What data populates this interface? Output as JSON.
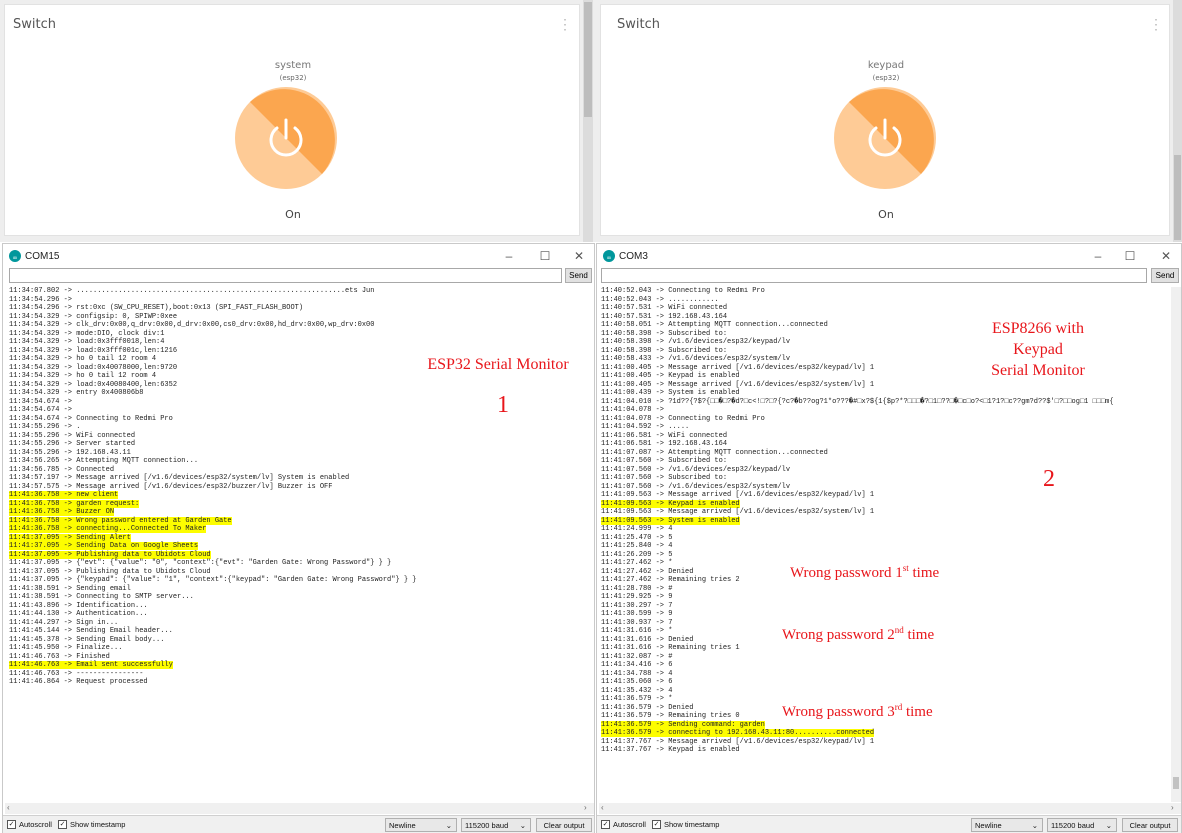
{
  "top_left": {
    "title": "Switch",
    "device": "system",
    "device_sub": "(esp32)",
    "state": "On"
  },
  "top_right": {
    "title": "Switch",
    "device": "keypad",
    "device_sub": "(esp32)",
    "state": "On"
  },
  "left_window": {
    "title": "COM15",
    "send_label": "Send",
    "autoscroll_label": "Autoscroll",
    "timestamp_label": "Show timestamp",
    "line_ending": "Newline",
    "baud": "115200 baud",
    "clear_label": "Clear output",
    "log": [
      {
        "t": "11:34:07.802 -> ................................................................ets Jun"
      },
      {
        "t": "11:34:54.296 ->"
      },
      {
        "t": "11:34:54.296 -> rst:0xc (SW_CPU_RESET),boot:0x13 (SPI_FAST_FLASH_BOOT)"
      },
      {
        "t": "11:34:54.329 -> configsip: 0, SPIWP:0xee"
      },
      {
        "t": "11:34:54.329 -> clk_drv:0x00,q_drv:0x00,d_drv:0x00,cs0_drv:0x00,hd_drv:0x00,wp_drv:0x00"
      },
      {
        "t": "11:34:54.329 -> mode:DIO, clock div:1"
      },
      {
        "t": "11:34:54.329 -> load:0x3fff0018,len:4"
      },
      {
        "t": "11:34:54.329 -> load:0x3fff001c,len:1216"
      },
      {
        "t": "11:34:54.329 -> ho 0 tail 12 room 4"
      },
      {
        "t": "11:34:54.329 -> load:0x40078000,len:9720"
      },
      {
        "t": "11:34:54.329 -> ho 0 tail 12 room 4"
      },
      {
        "t": "11:34:54.329 -> load:0x40080400,len:6352"
      },
      {
        "t": "11:34:54.329 -> entry 0x400806b8"
      },
      {
        "t": "11:34:54.674 ->"
      },
      {
        "t": "11:34:54.674 ->"
      },
      {
        "t": "11:34:54.674 -> Connecting to Redmi Pro"
      },
      {
        "t": "11:34:55.296 -> ."
      },
      {
        "t": "11:34:55.296 -> WiFi connected"
      },
      {
        "t": "11:34:55.296 -> Server started"
      },
      {
        "t": "11:34:55.296 -> 192.168.43.11"
      },
      {
        "t": "11:34:56.265 -> Attempting MQTT connection..."
      },
      {
        "t": "11:34:56.785 -> Connected"
      },
      {
        "t": "11:34:57.197 -> Message arrived [/v1.6/devices/esp32/system/lv] System is enabled"
      },
      {
        "t": "11:34:57.575 -> Message arrived [/v1.6/devices/esp32/buzzer/lv] Buzzer is OFF"
      },
      {
        "t": "11:41:36.758 -> new client",
        "h": true
      },
      {
        "t": "11:41:36.758 -> garden request:",
        "h": true
      },
      {
        "t": "11:41:36.758 -> Buzzer ON",
        "h": true
      },
      {
        "t": "11:41:36.758 -> Wrong password entered at Garden Gate",
        "h": true
      },
      {
        "t": "11:41:36.758 -> connecting...Connected To Maker",
        "h": true
      },
      {
        "t": "11:41:37.095 -> Sending Alert",
        "h": true
      },
      {
        "t": "11:41:37.095 -> Sending Data on Google Sheets",
        "h": true
      },
      {
        "t": "11:41:37.095 -> Publishing data to Ubidots Cloud",
        "h": true
      },
      {
        "t": "11:41:37.095 -> {\"evt\": {\"value\": \"0\", \"context\":{\"evt\": \"Garden Gate: Wrong Password\"} } }"
      },
      {
        "t": "11:41:37.095 -> Publishing data to Ubidots Cloud"
      },
      {
        "t": "11:41:37.095 -> {\"keypad\": {\"value\": \"1\", \"context\":{\"keypad\": \"Garden Gate: Wrong Password\"} } }"
      },
      {
        "t": "11:41:38.591 -> Sending email"
      },
      {
        "t": "11:41:38.591 -> Connecting to SMTP server..."
      },
      {
        "t": "11:41:43.896 -> Identification..."
      },
      {
        "t": "11:41:44.130 -> Authentication..."
      },
      {
        "t": "11:41:44.297 -> Sign in..."
      },
      {
        "t": "11:41:45.144 -> Sending Email header..."
      },
      {
        "t": "11:41:45.378 -> Sending Email body..."
      },
      {
        "t": "11:41:45.950 -> Finalize..."
      },
      {
        "t": "11:41:46.763 -> Finished"
      },
      {
        "t": "11:41:46.763 -> Email sent successfully",
        "h": true
      },
      {
        "t": "11:41:46.763 -> ----------------"
      },
      {
        "t": "11:41:46.864 -> Request processed"
      }
    ]
  },
  "right_window": {
    "title": "COM3",
    "send_label": "Send",
    "autoscroll_label": "Autoscroll",
    "timestamp_label": "Show timestamp",
    "line_ending": "Newline",
    "baud": "115200 baud",
    "clear_label": "Clear output",
    "log": [
      {
        "t": "11:40:52.043 -> Connecting to Redmi Pro"
      },
      {
        "t": "11:40:52.043 -> ............"
      },
      {
        "t": "11:40:57.531 -> WiFi connected"
      },
      {
        "t": "11:40:57.531 -> 192.168.43.164"
      },
      {
        "t": "11:40:58.051 -> Attempting MQTT connection...connected"
      },
      {
        "t": "11:40:58.398 -> Subscribed to:"
      },
      {
        "t": "11:40:58.398 -> /v1.6/devices/esp32/keypad/lv"
      },
      {
        "t": "11:40:58.398 -> Subscribed to:"
      },
      {
        "t": "11:40:58.433 -> /v1.6/devices/esp32/system/lv"
      },
      {
        "t": "11:41:00.405 -> Message arrived [/v1.6/devices/esp32/keypad/lv] 1"
      },
      {
        "t": "11:41:00.405 -> Keypad is enabled"
      },
      {
        "t": "11:41:00.405 -> Message arrived [/v1.6/devices/esp32/system/lv] 1"
      },
      {
        "t": "11:41:00.439 -> System is enabled"
      },
      {
        "t": "11:41:04.010 -> ?1d??{?$?{□□�□?�d?□c<!□?□?{?c?�b??og?1*o???�#□x?${1{$p?*?□□□�?□1□??□�□c□o?<□1?1?□c??gm?d??$'□?□□og□1 □□□m{"
      },
      {
        "t": "11:41:04.078 ->"
      },
      {
        "t": "11:41:04.078 -> Connecting to Redmi Pro"
      },
      {
        "t": "11:41:04.592 -> ....."
      },
      {
        "t": "11:41:06.581 -> WiFi connected"
      },
      {
        "t": "11:41:06.581 -> 192.168.43.164"
      },
      {
        "t": "11:41:07.087 -> Attempting MQTT connection...connected"
      },
      {
        "t": "11:41:07.560 -> Subscribed to:"
      },
      {
        "t": "11:41:07.560 -> /v1.6/devices/esp32/keypad/lv"
      },
      {
        "t": "11:41:07.560 -> Subscribed to:"
      },
      {
        "t": "11:41:07.560 -> /v1.6/devices/esp32/system/lv"
      },
      {
        "t": "11:41:09.563 -> Message arrived [/v1.6/devices/esp32/keypad/lv] 1"
      },
      {
        "t": "11:41:09.563 -> Keypad is enabled",
        "h": true
      },
      {
        "t": "11:41:09.563 -> Message arrived [/v1.6/devices/esp32/system/lv] 1"
      },
      {
        "t": "11:41:09.563 -> System is enabled",
        "h": true
      },
      {
        "t": "11:41:24.999 -> 4"
      },
      {
        "t": "11:41:25.470 -> 5"
      },
      {
        "t": "11:41:25.840 -> 4"
      },
      {
        "t": "11:41:26.209 -> 5"
      },
      {
        "t": "11:41:27.462 -> *"
      },
      {
        "t": "11:41:27.462 -> Denied"
      },
      {
        "t": "11:41:27.462 -> Remaining tries 2"
      },
      {
        "t": "11:41:28.780 -> #"
      },
      {
        "t": "11:41:29.925 -> 9"
      },
      {
        "t": "11:41:30.297 -> 7"
      },
      {
        "t": "11:41:30.599 -> 9"
      },
      {
        "t": "11:41:30.937 -> 7"
      },
      {
        "t": "11:41:31.616 -> *"
      },
      {
        "t": "11:41:31.616 -> Denied"
      },
      {
        "t": "11:41:31.616 -> Remaining tries 1"
      },
      {
        "t": "11:41:32.087 -> #"
      },
      {
        "t": "11:41:34.416 -> 6"
      },
      {
        "t": "11:41:34.788 -> 4"
      },
      {
        "t": "11:41:35.060 -> 6"
      },
      {
        "t": "11:41:35.432 -> 4"
      },
      {
        "t": "11:41:36.579 -> *"
      },
      {
        "t": "11:41:36.579 -> Denied"
      },
      {
        "t": "11:41:36.579 -> Remaining tries 0"
      },
      {
        "t": "11:41:36.579 -> Sending command: garden",
        "h": true
      },
      {
        "t": "11:41:36.579 -> connecting to 192.168.43.11:80..........connected",
        "h": true
      },
      {
        "t": "11:41:37.767 -> Message arrived [/v1.6/devices/esp32/keypad/lv] 1"
      },
      {
        "t": "11:41:37.767 -> Keypad is enabled"
      }
    ]
  },
  "annotations": {
    "esp32": "ESP32 Serial Monitor",
    "num1": "1",
    "esp8266_l1": "ESP8266 with",
    "esp8266_l2": "Keypad",
    "esp8266_l3": "Serial Monitor",
    "num2": "2",
    "wrong1_pre": "Wrong password 1",
    "wrong1_sup": "st",
    "wrong1_post": " time",
    "wrong2_pre": "Wrong password 2",
    "wrong2_sup": "nd",
    "wrong2_post": " time",
    "wrong3_pre": "Wrong password 3",
    "wrong3_sup": "rd",
    "wrong3_post": "  time"
  },
  "colors": {
    "power_dark": "#fba64f",
    "power_light": "#fecb96",
    "highlight": "#fdfd00",
    "annotation": "#e8161b"
  },
  "icons": {
    "power": "power-icon",
    "app": "arduino-icon"
  }
}
